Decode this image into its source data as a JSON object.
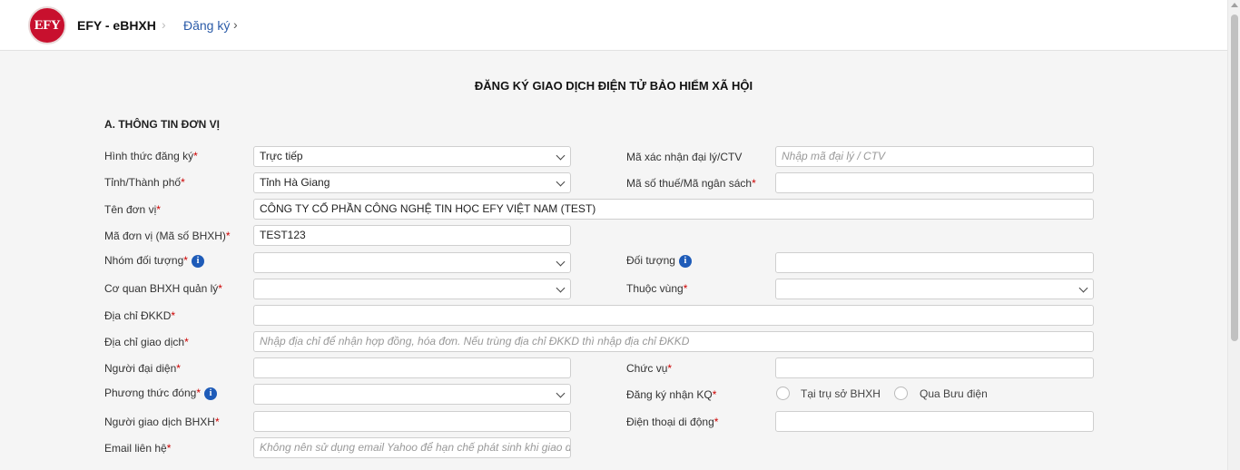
{
  "header": {
    "logo_text": "EFY",
    "brand": "EFY - eBHXH",
    "breadcrumb_sep": "›",
    "breadcrumb": "Đăng ký",
    "breadcrumb_arrow": "›"
  },
  "page_title": "ĐĂNG KÝ GIAO DỊCH ĐIỆN TỬ BẢO HIỂM XÃ HỘI",
  "section_a": "A. THÔNG TIN ĐƠN VỊ",
  "info_glyph": "i",
  "form": {
    "hinh_thuc": {
      "label": "Hình thức đăng ký",
      "value": "Trực tiếp"
    },
    "ma_xac_nhan": {
      "label": "Mã xác nhận đại lý/CTV",
      "placeholder": "Nhập mã đại lý / CTV"
    },
    "tinh": {
      "label": "Tỉnh/Thành phố",
      "value": "Tỉnh Hà Giang"
    },
    "ma_so_thue": {
      "label": "Mã số thuế/Mã ngân sách",
      "value": ""
    },
    "ten_don_vi": {
      "label": "Tên đơn vị",
      "value": "CÔNG TY CỔ PHẦN CÔNG NGHỆ TIN HỌC EFY VIỆT NAM (TEST)"
    },
    "ma_don_vi": {
      "label": "Mã đơn vị (Mã số BHXH)",
      "value": "TEST123"
    },
    "nhom_doi_tuong": {
      "label": "Nhóm đối tượng",
      "value": ""
    },
    "doi_tuong": {
      "label": "Đối tượng",
      "value": ""
    },
    "co_quan": {
      "label": "Cơ quan BHXH quản lý",
      "value": ""
    },
    "thuoc_vung": {
      "label": "Thuộc vùng",
      "value": ""
    },
    "dia_chi_dkkd": {
      "label": "Địa chỉ ĐKKD",
      "value": ""
    },
    "dia_chi_gd": {
      "label": "Địa chỉ giao dịch",
      "placeholder": "Nhập địa chỉ để nhận hợp đồng, hóa đơn. Nếu trùng địa chỉ ĐKKD thì nhập địa chỉ ĐKKD"
    },
    "nguoi_dai_dien": {
      "label": "Người đại diện",
      "value": ""
    },
    "chuc_vu": {
      "label": "Chức vụ",
      "value": ""
    },
    "phuong_thuc": {
      "label": "Phương thức đóng",
      "value": ""
    },
    "dang_ky_kq": {
      "label": "Đăng ký nhận KQ",
      "options": [
        "Tại trụ sở BHXH",
        "Qua Bưu điện"
      ]
    },
    "nguoi_gd": {
      "label": "Người giao dịch BHXH",
      "value": ""
    },
    "dien_thoai": {
      "label": "Điện thoại di động",
      "value": ""
    },
    "email": {
      "label": "Email liên hệ",
      "placeholder": "Không nên sử dụng email Yahoo để hạn chế phát sinh khi giao dịch"
    }
  },
  "required_mark": "*",
  "colors": {
    "brand_red": "#c8102e",
    "link_blue": "#2b5ba8",
    "info_blue": "#1e5bb8",
    "required_red": "#cc0000"
  }
}
